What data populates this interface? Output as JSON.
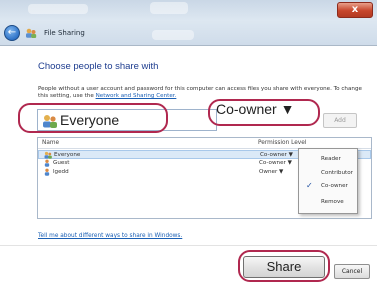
{
  "window": {
    "title": "File Sharing",
    "close_glyph": "x"
  },
  "heading": "Choose people to share with",
  "description": {
    "text": "People without a user account and password for this computer can access files you share with everyone. To change this setting, use the",
    "link": "Network and Sharing Center."
  },
  "name_field": {
    "value": "Everyone"
  },
  "permission_dropdown": {
    "selected": "Co-owner ▼"
  },
  "add_button": {
    "label": "Add"
  },
  "list": {
    "columns": [
      "Name",
      "Permission Level"
    ],
    "rows": [
      {
        "name": "Everyone",
        "permission": "Co-owner ▼",
        "icon": "group-icon"
      },
      {
        "name": "Guest",
        "permission": "Co-owner ▼",
        "icon": "user-icon"
      },
      {
        "name": "lgedd",
        "permission": "Owner ▼",
        "icon": "user-icon"
      }
    ]
  },
  "menu": {
    "items": [
      {
        "label": "Reader",
        "checked": false
      },
      {
        "label": "Contributor",
        "checked": false
      },
      {
        "label": "Co-owner",
        "checked": true
      },
      {
        "label": "Remove",
        "checked": false
      }
    ],
    "check_glyph": "✓"
  },
  "more_link": "Tell me about different ways to share in Windows.",
  "buttons": {
    "share": "Share",
    "cancel": "Cancel"
  },
  "colors": {
    "accent_highlight": "#b0284f",
    "link": "#1a5fb4",
    "heading": "#1e3d8f"
  }
}
